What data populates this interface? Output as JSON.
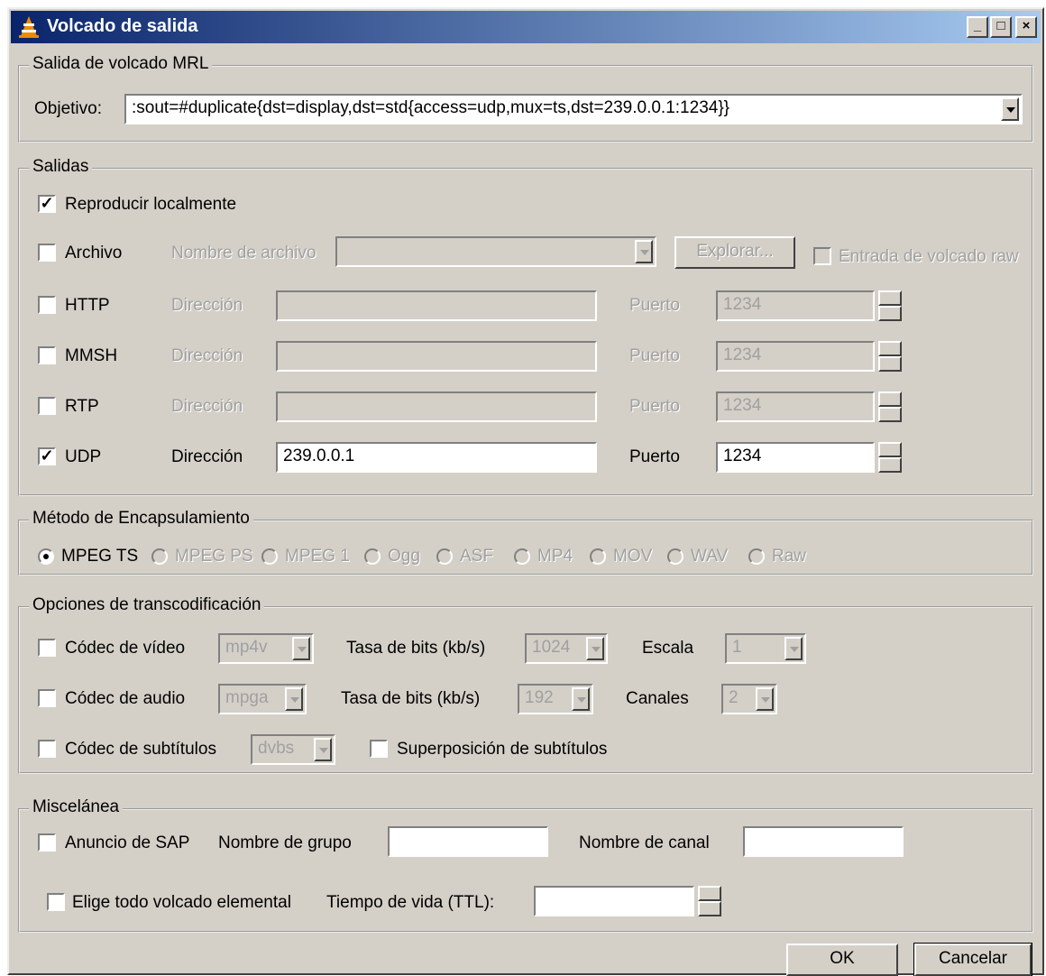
{
  "window": {
    "title": "Volcado de salida"
  },
  "mrl": {
    "legend": "Salida de volcado MRL",
    "target_label": "Objetivo:",
    "target_value": ":sout=#duplicate{dst=display,dst=std{access=udp,mux=ts,dst=239.0.0.1:1234}}"
  },
  "outputs": {
    "legend": "Salidas",
    "play_locally": {
      "label": "Reproducir localmente",
      "checked": true
    },
    "file": {
      "label": "Archivo",
      "name_label": "Nombre de archivo",
      "browse": "Explorar...",
      "raw_label": "Entrada de volcado raw"
    },
    "rows": [
      {
        "label": "HTTP",
        "addr_label": "Dirección",
        "address": "",
        "port_label": "Puerto",
        "port": "1234",
        "checked": false
      },
      {
        "label": "MMSH",
        "addr_label": "Dirección",
        "address": "",
        "port_label": "Puerto",
        "port": "1234",
        "checked": false
      },
      {
        "label": "RTP",
        "addr_label": "Dirección",
        "address": "",
        "port_label": "Puerto",
        "port": "1234",
        "checked": false
      },
      {
        "label": "UDP",
        "addr_label": "Dirección",
        "address": "239.0.0.1",
        "port_label": "Puerto",
        "port": "1234",
        "checked": true
      }
    ]
  },
  "encap": {
    "legend": "Método de Encapsulamiento",
    "options": [
      "MPEG TS",
      "MPEG PS",
      "MPEG 1",
      "Ogg",
      "ASF",
      "MP4",
      "MOV",
      "WAV",
      "Raw"
    ],
    "selected": "MPEG TS"
  },
  "transcode": {
    "legend": "Opciones de transcodificación",
    "video": {
      "label": "Códec de vídeo",
      "codec": "mp4v",
      "bitrate_label": "Tasa de bits (kb/s)",
      "bitrate": "1024",
      "scale_label": "Escala",
      "scale": "1"
    },
    "audio": {
      "label": "Códec de audio",
      "codec": "mpga",
      "bitrate_label": "Tasa de bits (kb/s)",
      "bitrate": "192",
      "channels_label": "Canales",
      "channels": "2"
    },
    "subs": {
      "label": "Códec de subtítulos",
      "codec": "dvbs",
      "overlay_label": "Superposición de subtítulos"
    }
  },
  "misc": {
    "legend": "Miscelánea",
    "sap_label": "Anuncio de SAP",
    "group_label": "Nombre de grupo",
    "channel_label": "Nombre de canal",
    "es_label": "Elige todo volcado elemental",
    "ttl_label": "Tiempo de vida (TTL):"
  },
  "buttons": {
    "ok": "OK",
    "cancel": "Cancelar"
  },
  "colors": {
    "titlebar_start": "#0a246a",
    "titlebar_end": "#a6caf0",
    "dialog_bg": "#d4d0c8"
  }
}
